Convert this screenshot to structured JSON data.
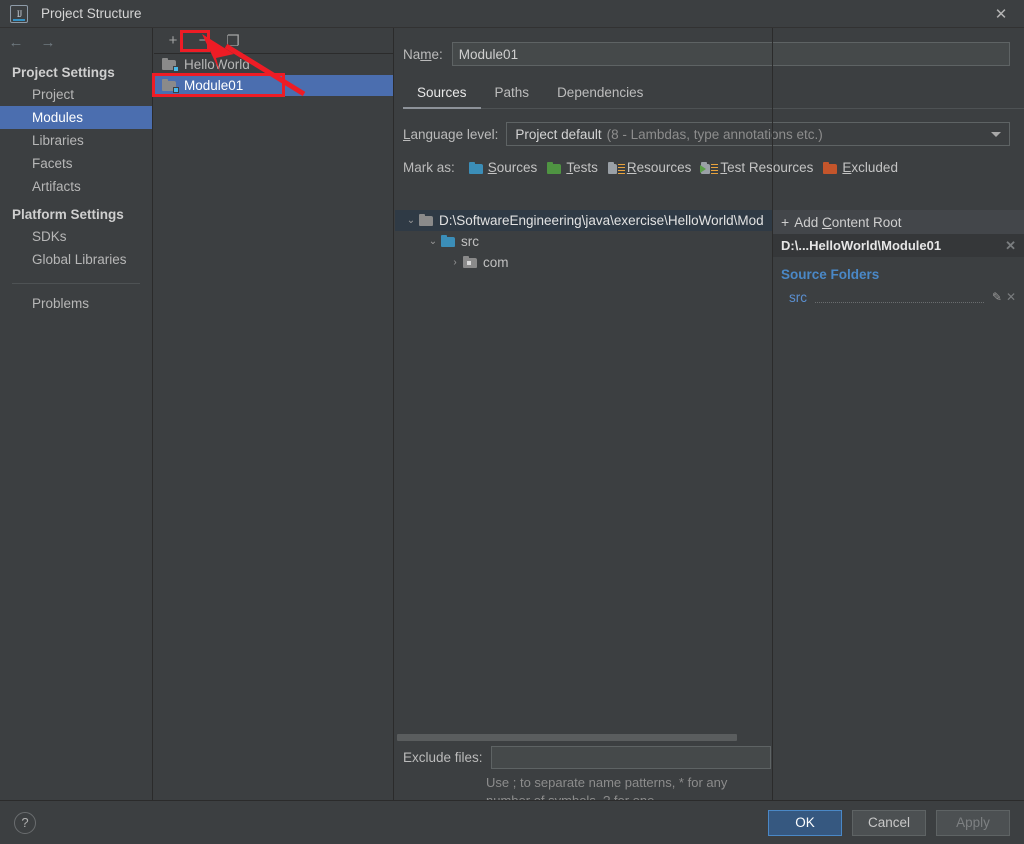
{
  "window": {
    "title": "Project Structure",
    "logo_text": "IJ",
    "close_icon": "✕"
  },
  "nav": {
    "back_icon": "←",
    "forward_icon": "→"
  },
  "sidebar": {
    "groups": [
      {
        "heading": "Project Settings",
        "items": [
          {
            "label": "Project",
            "selected": false
          },
          {
            "label": "Modules",
            "selected": true
          },
          {
            "label": "Libraries",
            "selected": false
          },
          {
            "label": "Facets",
            "selected": false
          },
          {
            "label": "Artifacts",
            "selected": false
          }
        ]
      },
      {
        "heading": "Platform Settings",
        "items": [
          {
            "label": "SDKs",
            "selected": false
          },
          {
            "label": "Global Libraries",
            "selected": false
          }
        ]
      }
    ],
    "problems": "Problems"
  },
  "modules_panel": {
    "toolbar": {
      "add_label": "+",
      "remove_label": "−",
      "copy_label": "❐"
    },
    "modules": [
      {
        "name": "HelloWorld",
        "selected": false
      },
      {
        "name": "Module01",
        "selected": true
      }
    ]
  },
  "detail": {
    "name_label_pre": "Na",
    "name_label_accel": "m",
    "name_label_post": "e:",
    "name_value": "Module01",
    "name_placeholder": "",
    "tabs": [
      {
        "label": "Sources",
        "active": true
      },
      {
        "label": "Paths",
        "active": false
      },
      {
        "label": "Dependencies",
        "active": false
      }
    ],
    "language_level": {
      "label_accel": "L",
      "label_rest": "anguage level:",
      "value": "Project default",
      "hint": "(8 - Lambdas, type annotations etc.)",
      "arrow_icon": "▼"
    },
    "mark_as": {
      "label": "Mark as:",
      "options": [
        {
          "accel": "S",
          "rest": "ources",
          "color": "#3b8eb8",
          "icon": "sources-folder-icon",
          "style": "plain"
        },
        {
          "accel": "T",
          "rest": "ests",
          "color": "#4f9442",
          "icon": "tests-folder-icon",
          "style": "plain"
        },
        {
          "accel": "R",
          "rest": "esources",
          "color": "#9aa0a6",
          "icon": "resources-folder-icon",
          "style": "lines"
        },
        {
          "accel": "T",
          "rest": "est Resources",
          "color": "#9aa0a6",
          "icon": "test-resources-folder-icon",
          "style": "testres"
        },
        {
          "accel": "E",
          "rest": "xcluded",
          "color": "#c4552b",
          "icon": "excluded-folder-icon",
          "style": "plain"
        }
      ]
    },
    "tree": [
      {
        "label": "D:\\SoftwareEngineering\\java\\exercise\\HelloWorld\\Mod",
        "indent": 0,
        "twisty": "⌄",
        "icon_color": "#8a8a8a",
        "selected": true,
        "icon_kind": "plain"
      },
      {
        "label": "src",
        "indent": 1,
        "twisty": "⌄",
        "icon_color": "#3b8eb8",
        "selected": false,
        "icon_kind": "plain"
      },
      {
        "label": "com",
        "indent": 2,
        "twisty": "›",
        "icon_color": "#8a8a8a",
        "selected": false,
        "icon_kind": "package"
      }
    ],
    "right_panel": {
      "add_content_root": {
        "plus": "+",
        "pre": "Add ",
        "accel": "C",
        "post": "ontent Root"
      },
      "root_path": "D:\\...HelloWorld\\Module01",
      "root_close_icon": "✕",
      "source_folders_title": "Source Folders",
      "source_folders": [
        {
          "name": "src",
          "edit_icon": "✎",
          "remove_icon": "✕"
        }
      ]
    },
    "exclude": {
      "label": "Exclude files:",
      "value": "",
      "placeholder": "",
      "hint_line1": "Use ; to separate name patterns, * for any",
      "hint_line2": "number of symbols, ? for one."
    }
  },
  "footer": {
    "help_icon": "?",
    "buttons": [
      {
        "label": "OK",
        "kind": "primary"
      },
      {
        "label": "Cancel",
        "kind": "normal"
      },
      {
        "label": "Apply",
        "kind": "disabled"
      }
    ]
  },
  "annotations": {
    "accent_color": "#ee1c25",
    "highlight_remove_button": true,
    "highlight_selected_module": true,
    "arrow_from_module_to_remove": true
  }
}
